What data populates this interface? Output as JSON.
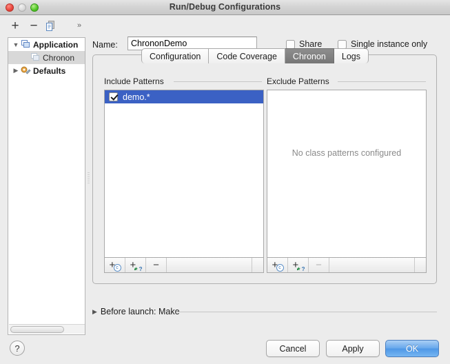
{
  "window": {
    "title": "Run/Debug Configurations",
    "traffic_lights": [
      "close-red",
      "minimize-gray",
      "zoom-green"
    ]
  },
  "toolbar": {
    "add_label": "+",
    "remove_label": "−",
    "copy_icon": "copy-icon",
    "more_label": "»"
  },
  "name_field": {
    "label": "Name:",
    "value": "ChrononDemo",
    "placeholder": ""
  },
  "options": [
    {
      "label": "Share",
      "checked": false
    },
    {
      "label": "Single instance only",
      "checked": false
    }
  ],
  "sidebar": {
    "items": [
      {
        "label": "Application",
        "icon": "application-window-icon",
        "expanded": true,
        "level": 0,
        "selected": false
      },
      {
        "label": "Chronon",
        "icon": "configuration-window-icon",
        "expanded": null,
        "level": 1,
        "selected": true
      },
      {
        "label": "Defaults",
        "icon": "defaults-gear-wrench-icon",
        "expanded": false,
        "level": 0,
        "selected": false
      }
    ],
    "expand_glyph": "▼",
    "collapse_glyph": "▶"
  },
  "tabs": [
    {
      "label": "Configuration",
      "active": false
    },
    {
      "label": "Code Coverage",
      "active": false
    },
    {
      "label": "Chronon",
      "active": true
    },
    {
      "label": "Logs",
      "active": false
    }
  ],
  "include_panel": {
    "title": "Include Patterns",
    "rows": [
      {
        "label": "demo.*",
        "checked": true,
        "selected": true
      }
    ],
    "buttons": [
      {
        "name": "add-class-pattern",
        "glyph": "+c",
        "enabled": true
      },
      {
        "name": "add-wildcard-pattern",
        "glyph": "+.*?",
        "enabled": true
      },
      {
        "name": "remove-pattern",
        "glyph": "−",
        "enabled": true
      }
    ]
  },
  "exclude_panel": {
    "title": "Exclude Patterns",
    "empty_message": "No class patterns configured",
    "rows": [],
    "buttons": [
      {
        "name": "add-class-pattern",
        "glyph": "+c",
        "enabled": true
      },
      {
        "name": "add-wildcard-pattern",
        "glyph": "+.*?",
        "enabled": true
      },
      {
        "name": "remove-pattern",
        "glyph": "−",
        "enabled": false
      }
    ]
  },
  "before_launch": {
    "triangle": "▶",
    "label": "Before launch: Make"
  },
  "footer": {
    "help_label": "?",
    "cancel_label": "Cancel",
    "apply_label": "Apply",
    "ok_label": "OK"
  },
  "colors": {
    "selection_blue": "#3b61c4",
    "tree_selection_gray": "#d8d8d8",
    "active_tab_gray": "#7c7c7c",
    "primary_button_blue": "#4e97e6",
    "window_bg": "#ececec"
  }
}
